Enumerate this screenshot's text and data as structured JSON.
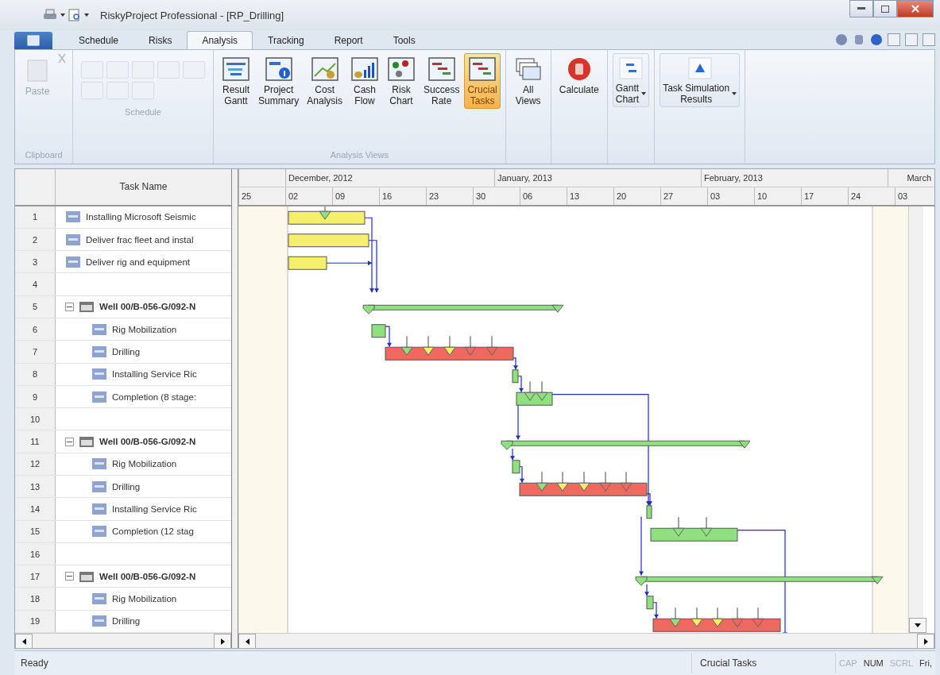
{
  "window": {
    "title": "RiskyProject Professional - [RP_Drilling]"
  },
  "tabs": [
    {
      "label": "Schedule",
      "selected": false
    },
    {
      "label": "Risks",
      "selected": false
    },
    {
      "label": "Analysis",
      "selected": true
    },
    {
      "label": "Tracking",
      "selected": false
    },
    {
      "label": "Report",
      "selected": false
    },
    {
      "label": "Tools",
      "selected": false
    }
  ],
  "ribbon": {
    "groups": [
      {
        "kind": "clipboard",
        "label": "Clipboard",
        "buttons": [
          {
            "label": "Paste",
            "disabled": true
          }
        ]
      },
      {
        "kind": "icon-grid",
        "label": "Schedule"
      },
      {
        "kind": "large",
        "label": "Analysis Views",
        "buttons": [
          {
            "label": "Result\nGantt",
            "selected": false
          },
          {
            "label": "Project\nSummary",
            "selected": false
          },
          {
            "label": "Cost\nAnalysis",
            "selected": false
          },
          {
            "label": "Cash\nFlow",
            "selected": false
          },
          {
            "label": "Risk\nChart",
            "selected": false
          },
          {
            "label": "Success\nRate",
            "selected": false
          },
          {
            "label": "Crucial\nTasks",
            "selected": true
          }
        ]
      },
      {
        "kind": "large",
        "buttons": [
          {
            "label": "All\nViews",
            "selected": false
          }
        ]
      },
      {
        "kind": "large",
        "buttons": [
          {
            "label": "Calculate",
            "selected": false
          }
        ]
      },
      {
        "kind": "large",
        "buttons": [
          {
            "label": "Gantt\nChart",
            "selected": false,
            "dropdown": true
          }
        ]
      },
      {
        "kind": "large",
        "buttons": [
          {
            "label": "Task Simulation\nResults",
            "selected": false,
            "dropdown": true
          }
        ]
      }
    ]
  },
  "table": {
    "columns": [
      "Task Name"
    ],
    "rows": [
      {
        "num": "1",
        "name": "Installing Microsoft Seismic",
        "kind": "task",
        "color": "#f5f06a"
      },
      {
        "num": "2",
        "name": "Deliver frac fleet and instal",
        "kind": "task",
        "color": "#f5f06a"
      },
      {
        "num": "3",
        "name": "Deliver rig and equipment",
        "kind": "task",
        "color": "#f5f06a"
      },
      {
        "num": "4",
        "kind": "blank"
      },
      {
        "num": "5",
        "name": "Well 00/B-056-G/092-N",
        "kind": "summary",
        "expanded": true,
        "color": "#8fe07f",
        "children": [
          {
            "num": "6",
            "name": "Rig Mobilization",
            "kind": "task",
            "color": "#8fe07f"
          },
          {
            "num": "7",
            "name": "Drilling",
            "kind": "task",
            "color": "#ee6a5e"
          },
          {
            "num": "8",
            "name": "Installing Service Ric",
            "kind": "task",
            "color": "#8fe07f"
          },
          {
            "num": "9",
            "name": "Completion (8 stage:",
            "kind": "task",
            "color": "#8fe07f"
          }
        ]
      },
      {
        "num": "10",
        "kind": "blank"
      },
      {
        "num": "11",
        "name": "Well 00/B-056-G/092-N",
        "kind": "summary",
        "expanded": true,
        "color": "#8fe07f",
        "children": [
          {
            "num": "12",
            "name": "Rig Mobilization",
            "kind": "task",
            "color": "#8fe07f"
          },
          {
            "num": "13",
            "name": "Drilling",
            "kind": "task",
            "color": "#ee6a5e"
          },
          {
            "num": "14",
            "name": "Installing Service Ric",
            "kind": "task",
            "color": "#8fe07f"
          },
          {
            "num": "15",
            "name": "Completion (12 stag",
            "kind": "task",
            "color": "#8fe07f"
          }
        ]
      },
      {
        "num": "16",
        "kind": "blank"
      },
      {
        "num": "17",
        "name": "Well 00/B-056-G/092-N",
        "kind": "summary",
        "expanded": true,
        "color": "#8fe07f",
        "children": [
          {
            "num": "18",
            "name": "Rig Mobilization",
            "kind": "task",
            "color": "#8fe07f"
          },
          {
            "num": "19",
            "name": "Drilling",
            "kind": "task",
            "color": "#ee6a5e"
          }
        ]
      }
    ]
  },
  "timeline": {
    "months": [
      "December, 2012",
      "January, 2013",
      "February, 2013",
      "March"
    ],
    "weeks": [
      "25",
      "02",
      "09",
      "16",
      "23",
      "30",
      "06",
      "13",
      "20",
      "27",
      "03",
      "10",
      "17",
      "24",
      "03"
    ]
  },
  "status_bar": {
    "message": "Ready",
    "view": "Crucial Tasks",
    "indicators": [
      {
        "label": "CAP",
        "on": false
      },
      {
        "label": "NUM",
        "on": true
      },
      {
        "label": "SCRL",
        "on": false
      },
      {
        "label": "Fri,",
        "on": true
      }
    ]
  }
}
